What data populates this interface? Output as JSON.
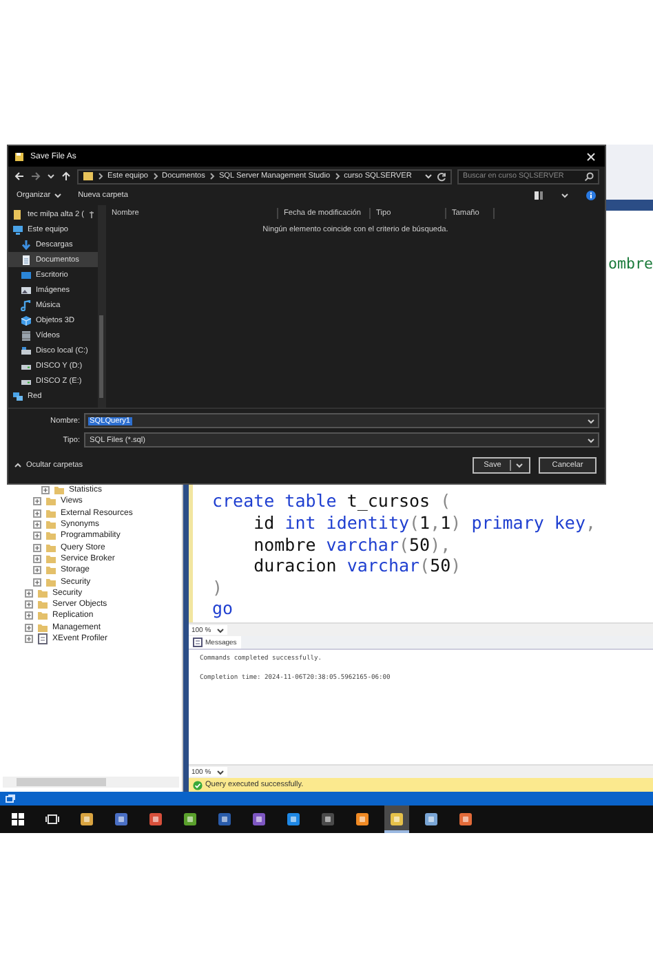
{
  "dialog": {
    "title": "Save File As",
    "breadcrumb": [
      "Este equipo",
      "Documentos",
      "SQL Server Management Studio",
      "curso SQLSERVER"
    ],
    "search": {
      "placeholder": "Buscar en curso SQLSERVER"
    },
    "toolbar": {
      "organize": "Organizar",
      "new_folder": "Nueva carpeta"
    },
    "nav": [
      {
        "label": "tec milpa alta 2 (",
        "kind": "folder",
        "selected": false
      },
      {
        "label": "Este equipo",
        "kind": "pc",
        "selected": false,
        "children": [
          {
            "label": "Descargas",
            "kind": "download",
            "selected": false
          },
          {
            "label": "Documentos",
            "kind": "document",
            "selected": true
          },
          {
            "label": "Escritorio",
            "kind": "desktop",
            "selected": false
          },
          {
            "label": "Imágenes",
            "kind": "image",
            "selected": false
          },
          {
            "label": "Música",
            "kind": "music",
            "selected": false
          },
          {
            "label": "Objetos 3D",
            "kind": "cube",
            "selected": false
          },
          {
            "label": "Vídeos",
            "kind": "video",
            "selected": false
          },
          {
            "label": "Disco local (C:)",
            "kind": "disk",
            "selected": false
          },
          {
            "label": "DISCO Y (D:)",
            "kind": "drive",
            "selected": false
          },
          {
            "label": "DISCO Z (E:)",
            "kind": "drive",
            "selected": false
          }
        ]
      },
      {
        "label": "Red",
        "kind": "network",
        "selected": false
      }
    ],
    "columns": [
      "Nombre",
      "Fecha de modificación",
      "Tipo",
      "Tamaño"
    ],
    "empty_message": "Ningún elemento coincide con el criterio de búsqueda.",
    "filename": {
      "label": "Nombre:",
      "value": "SQLQuery1",
      "text_selected": true
    },
    "filetype": {
      "label": "Tipo:",
      "value": "SQL Files (*.sql)"
    },
    "hide_folders": "Ocultar carpetas",
    "buttons": [
      {
        "label": "Save",
        "kind": "split"
      },
      {
        "label": "Cancelar",
        "kind": "plain"
      }
    ]
  },
  "editor": {
    "peek_text": "ombre",
    "lines": [
      [
        {
          "text": "create table",
          "kind": "keyword"
        },
        {
          "text": " t_cursos ",
          "kind": "text"
        },
        {
          "text": "(",
          "kind": "punct"
        }
      ],
      [
        {
          "text": "    id ",
          "kind": "text"
        },
        {
          "text": "int identity",
          "kind": "keyword"
        },
        {
          "text": "(",
          "kind": "punct"
        },
        {
          "text": "1",
          "kind": "text"
        },
        {
          "text": ",",
          "kind": "punct"
        },
        {
          "text": "1",
          "kind": "text"
        },
        {
          "text": ") ",
          "kind": "punct"
        },
        {
          "text": "primary key",
          "kind": "keyword"
        },
        {
          "text": ",",
          "kind": "punct"
        }
      ],
      [
        {
          "text": "    nombre ",
          "kind": "text"
        },
        {
          "text": "varchar",
          "kind": "keyword"
        },
        {
          "text": "(",
          "kind": "punct"
        },
        {
          "text": "50",
          "kind": "text"
        },
        {
          "text": "),",
          "kind": "punct"
        }
      ],
      [
        {
          "text": "    duracion ",
          "kind": "text"
        },
        {
          "text": "varchar",
          "kind": "keyword"
        },
        {
          "text": "(",
          "kind": "punct"
        },
        {
          "text": "50",
          "kind": "text"
        },
        {
          "text": ")",
          "kind": "punct"
        }
      ],
      [
        {
          "text": ")",
          "kind": "punct"
        }
      ],
      [
        {
          "text": "go",
          "kind": "keyword"
        }
      ]
    ],
    "zoom": "100 %"
  },
  "results": {
    "tab": "Messages",
    "messages": [
      "Commands completed successfully.",
      "Completion time: 2024-11-06T20:38:05.5962165-06:00"
    ],
    "zoom": "100 %"
  },
  "status_bar": {
    "text": "Query executed successfully."
  },
  "explorer": {
    "tree": [
      {
        "children": [
          {
            "children": [
              {
                "label": "Statistics",
                "kind": "folder"
              }
            ]
          },
          {
            "label": "Views",
            "kind": "folder"
          },
          {
            "label": "External Resources",
            "kind": "folder"
          },
          {
            "label": "Synonyms",
            "kind": "folder"
          },
          {
            "label": "Programmability",
            "kind": "folder"
          },
          {
            "label": "Query Store",
            "kind": "folder"
          },
          {
            "label": "Service Broker",
            "kind": "folder"
          },
          {
            "label": "Storage",
            "kind": "folder"
          },
          {
            "label": "Security",
            "kind": "folder"
          }
        ]
      },
      {
        "label": "Security",
        "kind": "folder"
      },
      {
        "label": "Server Objects",
        "kind": "folder"
      },
      {
        "label": "Replication",
        "kind": "folder"
      },
      {
        "label": "Management",
        "kind": "folder"
      },
      {
        "label": "XEvent Profiler",
        "kind": "profiler"
      }
    ]
  },
  "taskbar": [
    {
      "kind": "start",
      "selected": false
    },
    {
      "kind": "taskview",
      "selected": false
    },
    {
      "kind": "app",
      "color": "#d9a441",
      "selected": false
    },
    {
      "kind": "app",
      "color": "#4a6fc4",
      "selected": false
    },
    {
      "kind": "app",
      "color": "#d8503c",
      "selected": false
    },
    {
      "kind": "app",
      "color": "#5aa02c",
      "selected": false
    },
    {
      "kind": "app",
      "color": "#2a5caa",
      "selected": false
    },
    {
      "kind": "app",
      "color": "#7e57c2",
      "selected": false
    },
    {
      "kind": "app",
      "color": "#1e88e5",
      "selected": false
    },
    {
      "kind": "app",
      "color": "#4a4a4a",
      "selected": false
    },
    {
      "kind": "app",
      "color": "#f08a24",
      "selected": false
    },
    {
      "kind": "app",
      "color": "#e6c14a",
      "selected": true
    },
    {
      "kind": "app",
      "color": "#7aa6d6",
      "selected": false
    },
    {
      "kind": "app",
      "color": "#e26b3a",
      "selected": false
    }
  ]
}
